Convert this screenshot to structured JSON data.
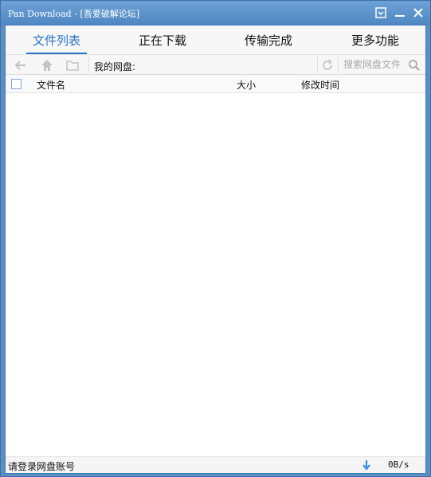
{
  "window": {
    "title": "Pan Download - [吾爱破解论坛]"
  },
  "tabs": [
    {
      "label": "文件列表",
      "active": true
    },
    {
      "label": "正在下载",
      "active": false
    },
    {
      "label": "传输完成",
      "active": false
    },
    {
      "label": "更多功能",
      "active": false
    }
  ],
  "toolbar": {
    "icons": [
      "back-arrow-icon",
      "home-icon",
      "folder-icon",
      "refresh-icon",
      "search-icon"
    ],
    "path_label": "我的网盘:",
    "search_placeholder": "搜索网盘文件"
  },
  "file_table": {
    "columns": {
      "name": "文件名",
      "size": "大小",
      "modified": "修改时间"
    },
    "rows": []
  },
  "statusbar": {
    "message": "请登录网盘账号",
    "speed": "0B/s"
  },
  "colors": {
    "accent": "#2c74c6",
    "window_frame": "#5a8fc6",
    "download_icon": "#3a8ee6"
  }
}
